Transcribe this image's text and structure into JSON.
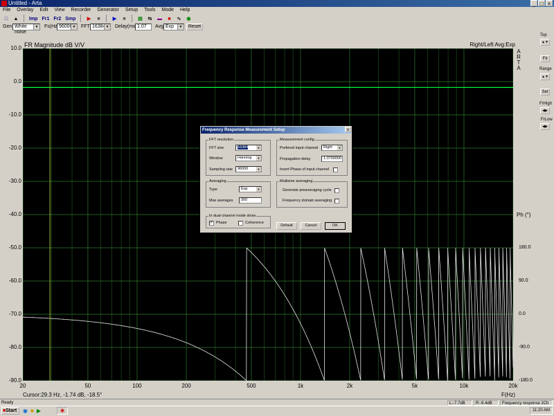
{
  "window": {
    "title": "Untitled - Arta",
    "controls": [
      "_",
      "□",
      "×"
    ]
  },
  "menu": [
    "File",
    "Overlay",
    "Edit",
    "View",
    "Recorder",
    "Generator",
    "Setup",
    "Tools",
    "Mode",
    "Help"
  ],
  "toolbar": {
    "buttons": [
      "Imp",
      "Fr1",
      "Fr2",
      "Smp"
    ]
  },
  "gen_bar": {
    "gen_label": "Gen",
    "gen_value": "White noise",
    "fs_label": "Fs(Hz)",
    "fs_value": "96000",
    "fft_label": "FFT",
    "fft_value": "16384",
    "delay_label": "Delay(ms)",
    "delay_value": "1.07",
    "avg_label": "Avg",
    "avg_value": "Exp",
    "reset_label": "Reset"
  },
  "right_panel": {
    "top_label": "Top",
    "fit_label": "Fit",
    "range_label": "Range",
    "set_label": "Set",
    "frhigh_label": "FrHigh",
    "frlow_label": "FrLow",
    "arta": [
      "A",
      "R",
      "T",
      "A"
    ]
  },
  "plot": {
    "title": "FR Magnitude dB V/V",
    "right_title": "Right/Left Avg:Exp",
    "phase_title": "Ph (°)",
    "x_axis_label": "F(Hz)",
    "cursor_text": "Cursor:29.3 Hz, -1.74 dB, -18.5°"
  },
  "chart_data": {
    "type": "line",
    "xscale": "log",
    "xlim": [
      20,
      20000
    ],
    "ylim": [
      -90,
      10
    ],
    "phase_lim": [
      -180,
      180
    ],
    "y_ticks": [
      "10.0",
      "0.0",
      "-10.0",
      "-20.0",
      "-30.0",
      "-40.0",
      "-50.0",
      "-60.0",
      "-70.0",
      "-80.0",
      "-90.0"
    ],
    "x_ticks": [
      "20",
      "50",
      "100",
      "200",
      "500",
      "1k",
      "2k",
      "5k",
      "10k",
      "20k"
    ],
    "x_tick_values": [
      20,
      50,
      100,
      200,
      500,
      1000,
      2000,
      5000,
      10000,
      20000
    ],
    "phase_ticks": [
      "180.0",
      "90.0",
      "0.0",
      "-90.0",
      "-180.0"
    ],
    "cursor_x": 29.3,
    "series": [
      {
        "color": "#00ff40",
        "x": [
          20,
          50,
          100,
          1000,
          20000
        ],
        "y": [
          -1.74,
          -1.74,
          -1.74,
          -1.7,
          -1.75
        ]
      },
      {
        "color": "#ffffff",
        "type": "phase",
        "phase_delay_ms": 1.07
      }
    ],
    "grid": true
  },
  "dialog": {
    "title": "Frequency Response Measurement Setup",
    "close_label": "x",
    "fft_group": "FFT resolution",
    "fft_size_label": "FFT size",
    "fft_size_value": "16384",
    "window_label": "Window",
    "window_value": "Hanning",
    "sr_label": "Sampling rate",
    "sr_value": "96000",
    "avg_group": "Averaging",
    "type_label": "Type",
    "type_value": "Exp",
    "maxavg_label": "Max averages",
    "maxavg_value": "300",
    "dual_group": "In dual-channel mode show",
    "phase_label": "Phase",
    "coherence_label": "Coherence",
    "meas_group": "Measurement config",
    "pref_label": "Prefered input channel",
    "pref_value": "Right",
    "prop_label": "Propagation delay",
    "prop_value": "1.0700000",
    "invert_label": "Invert Phase of input channel",
    "multi_group": "Multisine averaging",
    "gen_pre_label": "Generate preaveraging cycle",
    "freq_dom_label": "Frequency domain averaging",
    "default_btn": "Default",
    "cancel_btn": "Cancel",
    "ok_btn": "OK"
  },
  "status": {
    "ready": "Ready",
    "l_level": "L:-7.7dB",
    "r_level": "R:-9.4dB",
    "mode": "Frequency response 2Ch"
  },
  "taskbar": {
    "start": "Start",
    "clock": "11:20 AM"
  }
}
